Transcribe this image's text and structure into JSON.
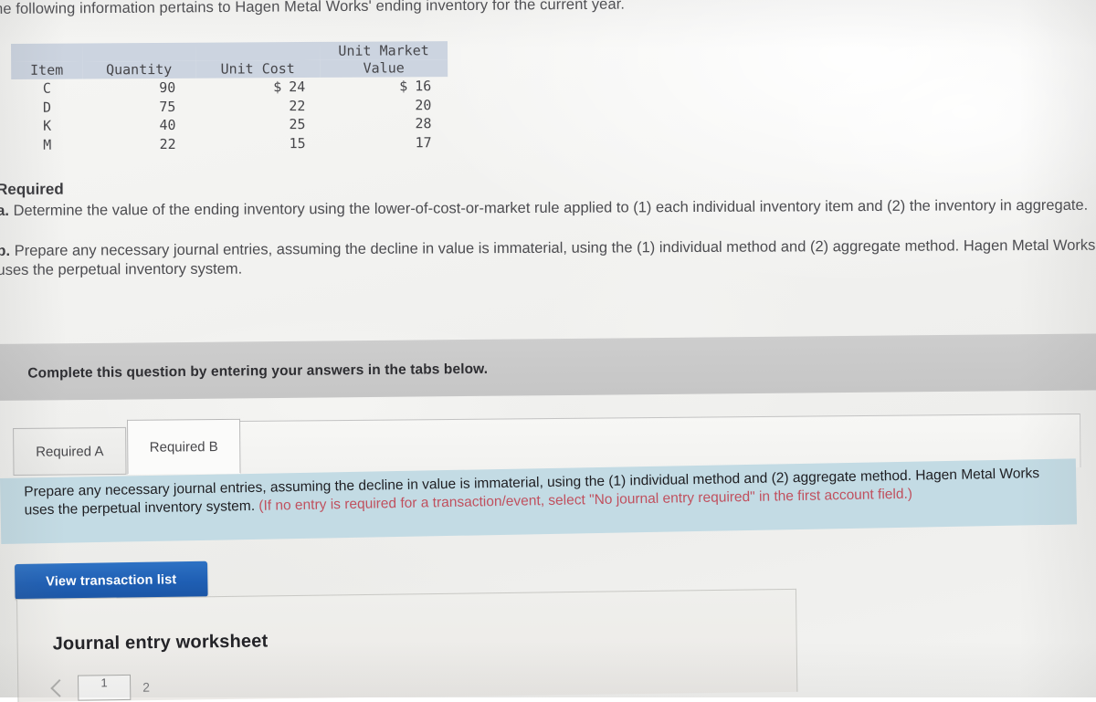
{
  "stem": {
    "text": "he following information pertains to Hagen Metal Works' ending inventory for the current year."
  },
  "inventory_table": {
    "headers": {
      "item": "Item",
      "quantity": "Quantity",
      "unit_cost": "Unit Cost",
      "unit_market_value_line1": "Unit Market",
      "unit_market_value_line2": "Value"
    },
    "rows": [
      {
        "item": "C",
        "quantity": "90",
        "unit_cost_symbol": "$",
        "unit_cost": "24",
        "market_symbol": "$",
        "market": "16"
      },
      {
        "item": "D",
        "quantity": "75",
        "unit_cost_symbol": "",
        "unit_cost": "22",
        "market_symbol": "",
        "market": "20"
      },
      {
        "item": "K",
        "quantity": "40",
        "unit_cost_symbol": "",
        "unit_cost": "25",
        "market_symbol": "",
        "market": "28"
      },
      {
        "item": "M",
        "quantity": "22",
        "unit_cost_symbol": "",
        "unit_cost": "15",
        "market_symbol": "",
        "market": "17"
      }
    ],
    "header_bg": "#ccd4e0"
  },
  "required": {
    "heading": "Required",
    "a_label": "a.",
    "a_text": "Determine the value of the ending inventory using the lower-of-cost-or-market rule applied to (1) each individual inventory item and (2) the inventory in aggregate.",
    "b_label": "b.",
    "b_text": "Prepare any necessary journal entries, assuming the decline in value is immaterial, using the (1) individual method and (2) aggregate method. Hagen Metal Works uses the perpetual inventory system."
  },
  "complete_banner": {
    "text": "Complete this question by entering your answers in the tabs below."
  },
  "tabs": [
    {
      "label": "Required A",
      "active": false
    },
    {
      "label": "Required B",
      "active": true
    }
  ],
  "instruction_panel": {
    "main_text": "Prepare any necessary journal entries, assuming the decline in value is immaterial, using the (1) individual method and (2) aggregate method. Hagen Metal Works uses the perpetual inventory system. ",
    "note_text": "(If no entry is required for a transaction/event, select \"No journal entry required\" in the first account field.)",
    "bg_color": "#c3dbe4",
    "note_color": "#c0505e"
  },
  "view_transaction_button": {
    "label": "View transaction list",
    "color": "#1f5fb4"
  },
  "worksheet": {
    "title": "Journal entry worksheet",
    "pager": {
      "current_page": "1",
      "next_page": "2"
    }
  }
}
